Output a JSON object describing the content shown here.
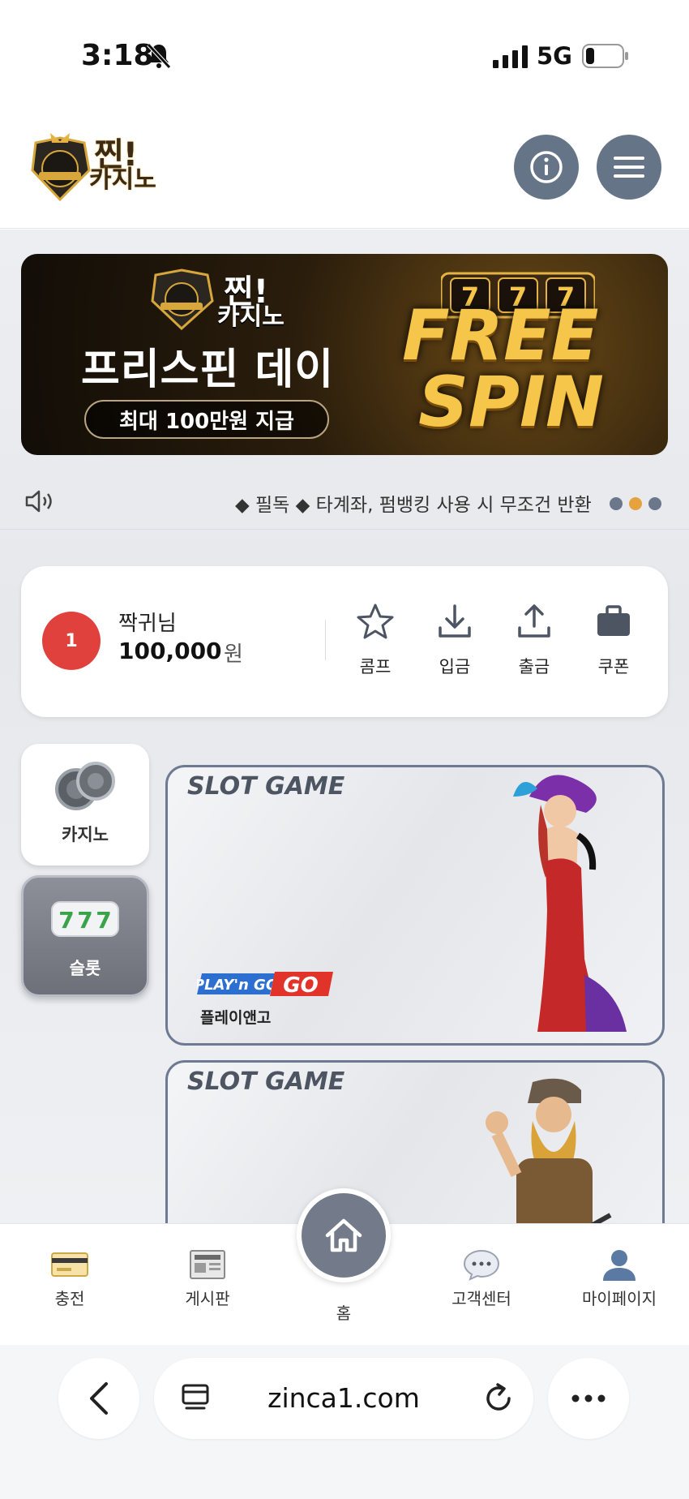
{
  "status_bar": {
    "time": "3:18",
    "network": "5G"
  },
  "header": {
    "logo_line1": "찐!",
    "logo_line2": "카지노"
  },
  "banner": {
    "logo_line1": "찐!",
    "logo_line2": "카지노",
    "title": "프리스핀 데이",
    "pill": "최대 100만원 지급",
    "free": "FREE",
    "spin": "SPIN"
  },
  "notice": {
    "text": "◆ 필독 ◆ 타계좌, 펌뱅킹 사용 시 무조건 반환",
    "dots": 3,
    "active_dot": 2
  },
  "user": {
    "level": "1",
    "name": "짝귀님",
    "balance": "100,000",
    "currency": "원",
    "actions": [
      {
        "label": "콤프",
        "icon": "star-icon"
      },
      {
        "label": "입금",
        "icon": "download-icon"
      },
      {
        "label": "출금",
        "icon": "upload-icon"
      },
      {
        "label": "쿠폰",
        "icon": "briefcase-icon"
      }
    ]
  },
  "categories": [
    {
      "label": "카지노",
      "icon": "casino-chips-icon",
      "selected": false
    },
    {
      "label": "슬롯",
      "icon": "slot-reels-icon",
      "selected": true
    }
  ],
  "games": [
    {
      "tag": "SLOT GAME",
      "provider_logo": "PLAY'n GO",
      "provider_name": "플레이앤고"
    },
    {
      "tag": "SLOT GAME"
    }
  ],
  "bottom_nav": {
    "items": [
      {
        "label": "충전",
        "icon": "card-icon"
      },
      {
        "label": "게시판",
        "icon": "newspaper-icon"
      },
      {
        "label": "홈",
        "icon": "home-icon"
      },
      {
        "label": "고객센터",
        "icon": "chat-bubble-icon"
      },
      {
        "label": "마이페이지",
        "icon": "user-icon"
      }
    ]
  },
  "browser": {
    "url": "zinca1.com"
  },
  "colors": {
    "accent_gray": "#667488",
    "level_badge": "#e0413d",
    "active_dot": "#e6a23c",
    "banner_gold": "#f6c64a"
  }
}
